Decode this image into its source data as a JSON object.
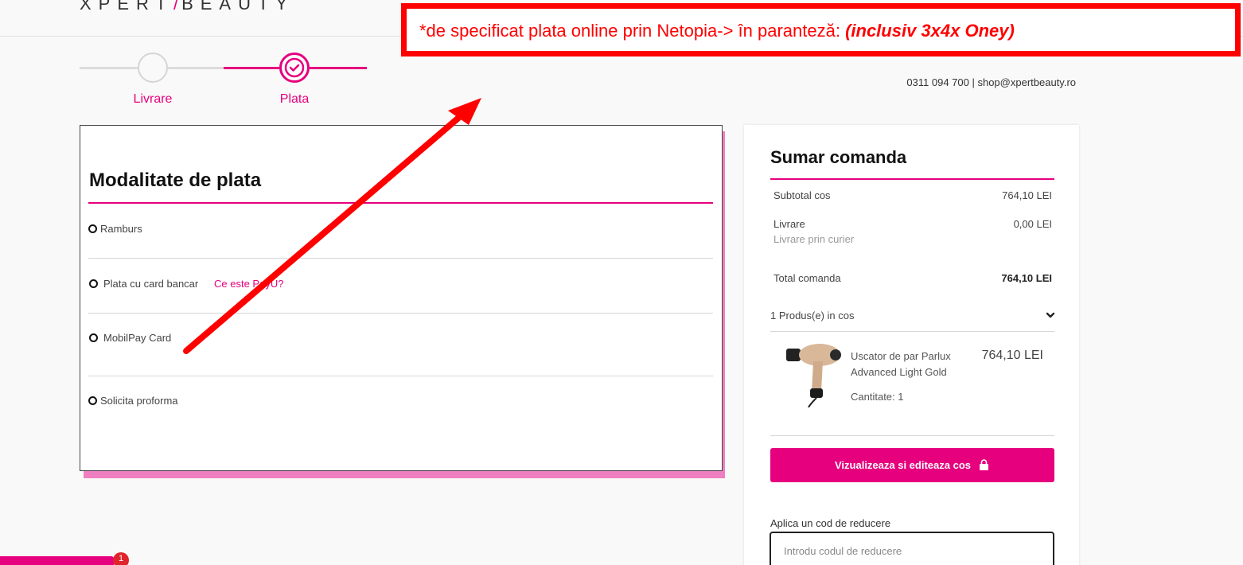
{
  "header": {
    "logo_left": "XPERT",
    "logo_slash": "/",
    "logo_right": "BEAUTY",
    "contact": "0311 094 700 | shop@xpertbeauty.ro"
  },
  "stepper": {
    "steps": [
      {
        "label": "Livrare",
        "state": "inactive"
      },
      {
        "label": "Plata",
        "state": "active"
      }
    ],
    "accent": "#e6007e"
  },
  "payment": {
    "title": "Modalitate de plata",
    "options": [
      {
        "label": "Ramburs"
      },
      {
        "label": "Plata cu card bancar",
        "link": "Ce este PayU?"
      },
      {
        "label": "MobilPay Card"
      },
      {
        "label": "Solicita proforma"
      }
    ]
  },
  "summary": {
    "title": "Sumar comanda",
    "subtotal_label": "Subtotal cos",
    "subtotal_value": "764,10 LEI",
    "shipping_label": "Livrare",
    "shipping_value": "0,00 LEI",
    "shipping_method": "Livrare prin curier",
    "total_label": "Total comanda",
    "total_value": "764,10 LEI",
    "products_count": "1 Produs(e) in cos",
    "product": {
      "name_line1": "Uscator de par Parlux",
      "name_line2": "Advanced Light Gold",
      "price": "764,10 LEI",
      "quantity": "Cantitate: 1"
    },
    "cart_button": "Vizualizeaza si editeaza cos",
    "discount_label": "Aplica un cod de reducere",
    "discount_placeholder": "Introdu codul de reducere"
  },
  "annotation": {
    "text": "*de specificat plata online prin Netopia-> în paranteză: ",
    "emphasis": "(inclusiv 3x4x Oney)",
    "color": "#ff0000"
  },
  "cart_badge": {
    "count": "1"
  },
  "icons": {
    "step_check": "check-circle-icon",
    "chevron": "chevron-down-icon",
    "bag": "shopping-bag-icon",
    "product": "hair-dryer-image",
    "arrow": "red-annotation-arrow"
  }
}
